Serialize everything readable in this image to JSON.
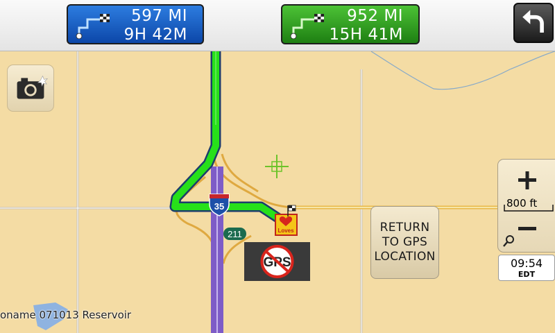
{
  "routes": [
    {
      "distance": "597 MI",
      "time": "9H 42M",
      "color": "#1a5cc4",
      "icon": "route-flag-icon"
    },
    {
      "distance": "952 MI",
      "time": "15H 41M",
      "color": "#2f9c1f",
      "icon": "route-flag-icon"
    }
  ],
  "back_icon": "back-arrow-icon",
  "camera_icon": "camera-icon",
  "zoom": {
    "plus": "+",
    "minus": "−",
    "scale_label": "800 ft",
    "magnifier_icon": "magnifier-icon"
  },
  "clock": {
    "time": "09:54",
    "zone": "EDT"
  },
  "return_button": {
    "label": "RETURN\nTO GPS\nLOCATION"
  },
  "map": {
    "interstate_shield": "35",
    "exit_number": "211",
    "poi_label": "oname 071013 Reservoir",
    "no_gps_label": "GPS",
    "poi_brand": "Loves",
    "route_color": "#27e01a"
  }
}
